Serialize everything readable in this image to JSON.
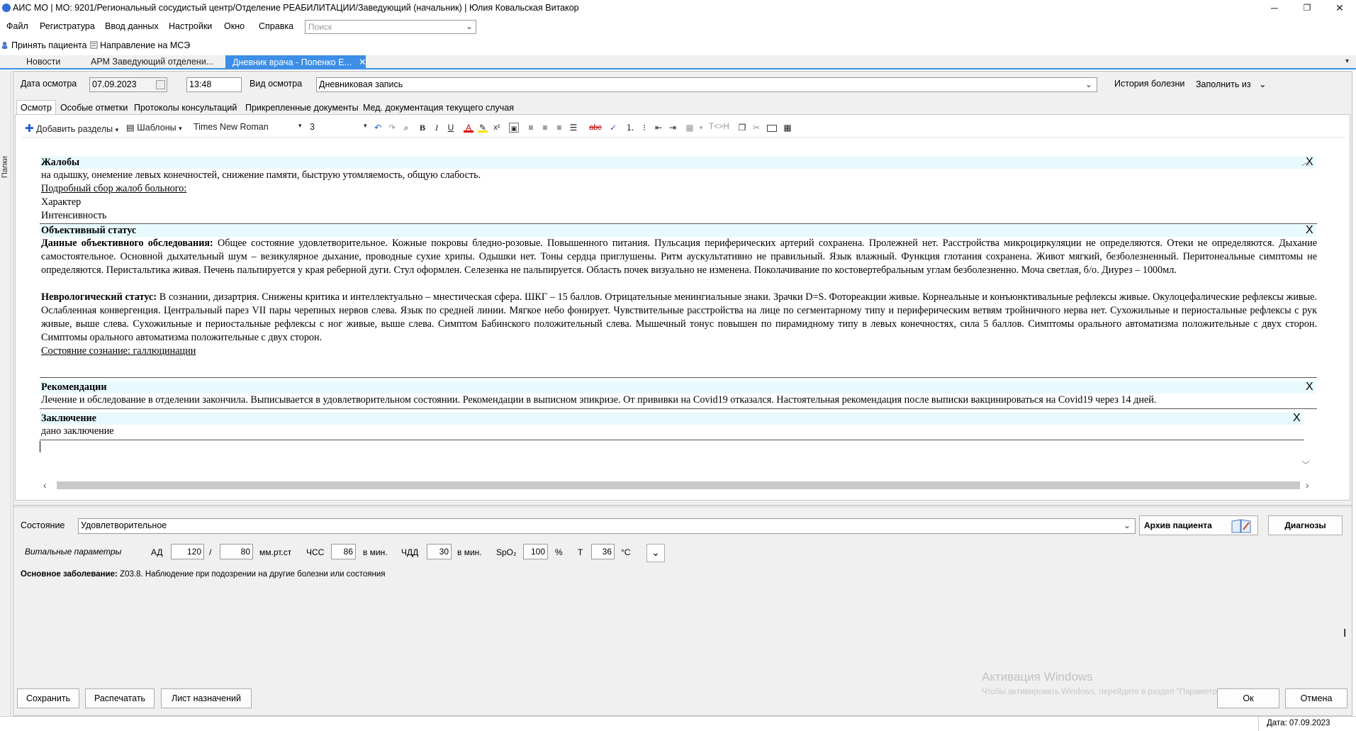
{
  "window": {
    "title": "АИС МО | МО: 9201/Региональный сосудистый центр/Отделение РЕАБИЛИТАЦИИ/Заведующий (начальник) | Юлия Ковальская Витакор",
    "minimize": "─",
    "maximize": "❐",
    "close": "✕"
  },
  "menu": {
    "items": [
      "Файл",
      "Регистратура",
      "Ввод данных",
      "Настройки",
      "Окно",
      "Справка"
    ],
    "search_placeholder": "Поиск"
  },
  "quickbar": {
    "accept_patient": "Принять пациента",
    "mse_referral": "Направление на МСЭ"
  },
  "tabs": [
    {
      "label": "Новости"
    },
    {
      "label": "АРМ Заведующий отделени..."
    },
    {
      "label": "Дневник врача - Попенко Е..."
    }
  ],
  "left_panel_label": "Папки",
  "exam": {
    "date_label": "Дата осмотра",
    "date_value": "07.09.2023",
    "time_value": "13:48",
    "type_label": "Вид осмотра",
    "type_value": "Дневниковая  запись",
    "history_label": "История болезни",
    "fill_from_label": "Заполнить из"
  },
  "subtabs": [
    "Осмотр",
    "Особые отметки",
    "Протоколы консультаций",
    "Прикрепленные документы",
    "Мед. документация текущего случая"
  ],
  "toolbar": {
    "add_sections": "Добавить разделы",
    "templates": "Шаблоны",
    "font_name": "Times New Roman",
    "font_size": "3",
    "bold": "B",
    "italic": "I",
    "underline": "U",
    "replace": "T<>H"
  },
  "document": {
    "close_glyph": "X",
    "complaints": {
      "title": "Жалобы",
      "text": "на одышку, онемение левых конечностей, снижение памяти, быструю утомляемость, общую слабость.",
      "details_label": "Подробный сбор жалоб больного:",
      "character": "Характер",
      "intensity": "Интенсивность"
    },
    "objective": {
      "title": "Объективный статус",
      "exam_label": "Данные объективного обследования:",
      "exam_text": "Общее состояние удовлетворительное. Кожные покровы бледно-розовые. Повышенного питания. Пульсация периферических артерий сохранена. Пролежней нет. Расстройства микроциркуляции не определяются. Отеки не определяются. Дыхание самостоятельное. Основной дыхательный шум – везикулярное дыхание, проводные сухие хрипы. Одышки нет. Тоны сердца приглушены. Ритм аускультативно не правильный. Язык влажный. Функция глотания сохранена. Живот мягкий, безболезненный. Перитонеальные симптомы не определяются. Перистальтика живая. Печень пальпируется у края реберной дуги. Стул оформлен. Селезенка не пальпируется. Область почек визуально не изменена. Поколачивание по костовертебральным углам безболезненно. Моча светлая, б/о. Диурез – 1000мл.",
      "neuro_label": "Неврологический статус:",
      "neuro_text": "В сознании, дизартрия. Снижены критика и интеллектуально – мнестическая сфера. ШКГ – 15 баллов. Отрицательные менингиальные знаки. Зрачки D=S. Фотореакции живые. Корнеальные и конъюнктивальные рефлексы живые. Окулоцефалические рефлексы живые. Ослабленная конвергенция. Центральный парез VII пары черепных нервов слева. Язык по средней линии. Мягкое небо фонирует. Чувствительные расстройства на лице по сегментарному типу и периферическим ветвям тройничного нерва нет. Сухожильные и периостальные рефлексы с рук живые, выше слева. Сухожильные и периостальные рефлексы с ног живые, выше слева. Симптом Бабинского положительный слева. Мышечный тонус повышен по пирамидному типу в левых конечностях, сила 5 баллов. Симптомы орального автоматизма положительные с двух сторон. Симптомы орального автоматизма положительные с двух сторон.",
      "consciousness": "Состояние сознание: галлюцинации"
    },
    "recommendations": {
      "title": "Рекомендации",
      "text": "Лечение и обследование в отделении закончила. Выписывается в удовлетворительном  состоянии. Рекомендации в выписном эпикризе. От прививки  на Covid19 отказался. Настоятельная рекомендация после выписки вакцинироваться на Covid19 через 14 дней."
    },
    "conclusion": {
      "title": "Заключение",
      "text": "дано заключение"
    }
  },
  "state": {
    "label": "Состояние",
    "value": "Удовлетворительное",
    "archive_button": "Архив пациента",
    "diagnoses_button": "Диагнозы"
  },
  "vitals": {
    "label": "Витальные параметры",
    "bp_label": "АД",
    "bp_sys": "120",
    "bp_sep": "/",
    "bp_dia": "80",
    "bp_unit": "мм.рт.ст",
    "hr_label": "ЧСС",
    "hr_value": "86",
    "hr_unit": "в мин.",
    "rr_label": "ЧДД",
    "rr_value": "30",
    "rr_unit": "в мин.",
    "spo2_label": "SpO₂",
    "spo2_value": "100",
    "spo2_unit": "%",
    "temp_label": "Т",
    "temp_value": "36",
    "temp_unit": "°С"
  },
  "main_disease": {
    "label": "Основное заболевание:",
    "value": "Z03.8. Наблюдение при подозрении на другие болезни или состояния"
  },
  "buttons": {
    "save": "Сохранить",
    "print": "Распечатать",
    "prescriptions": "Лист назначений",
    "ok": "Ок",
    "cancel": "Отмена"
  },
  "watermark": {
    "line1": "Активация Windows",
    "line2": "Чтобы активировать Windows, перейдите в раздел \"Параметры\"."
  },
  "statusbar": {
    "date": "Дата: 07.09.2023"
  },
  "colors": {
    "accent": "#3c8ee6",
    "section_bg": "#e8fafd"
  }
}
